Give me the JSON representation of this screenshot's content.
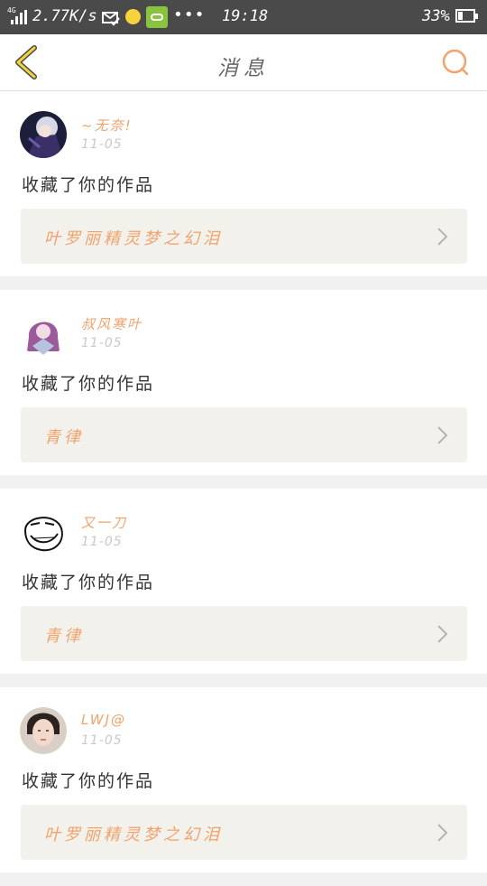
{
  "status_bar": {
    "network": "4G",
    "speed": "2.77K/s",
    "more": "•••",
    "time": "19:18",
    "battery_percent": "33%",
    "battery_level": 0.33
  },
  "header": {
    "title": "消息",
    "accent_color": "#f2a26b"
  },
  "messages": [
    {
      "user": "~无奈!",
      "time": "11-05",
      "action": "收藏了你的作品",
      "work": "叶罗丽精灵梦之幻泪",
      "avatar": "anime-boy-avatar"
    },
    {
      "user": "叔风寒叶",
      "time": "11-05",
      "action": "收藏了你的作品",
      "work": "青律",
      "avatar": "purple-hair-avatar"
    },
    {
      "user": "又一刀",
      "time": "11-05",
      "action": "收藏了你的作品",
      "work": "青律",
      "avatar": "troll-face-avatar"
    },
    {
      "user": "LWJ@",
      "time": "11-05",
      "action": "收藏了你的作品",
      "work": "叶罗丽精灵梦之幻泪",
      "avatar": "girl-photo-avatar"
    }
  ]
}
